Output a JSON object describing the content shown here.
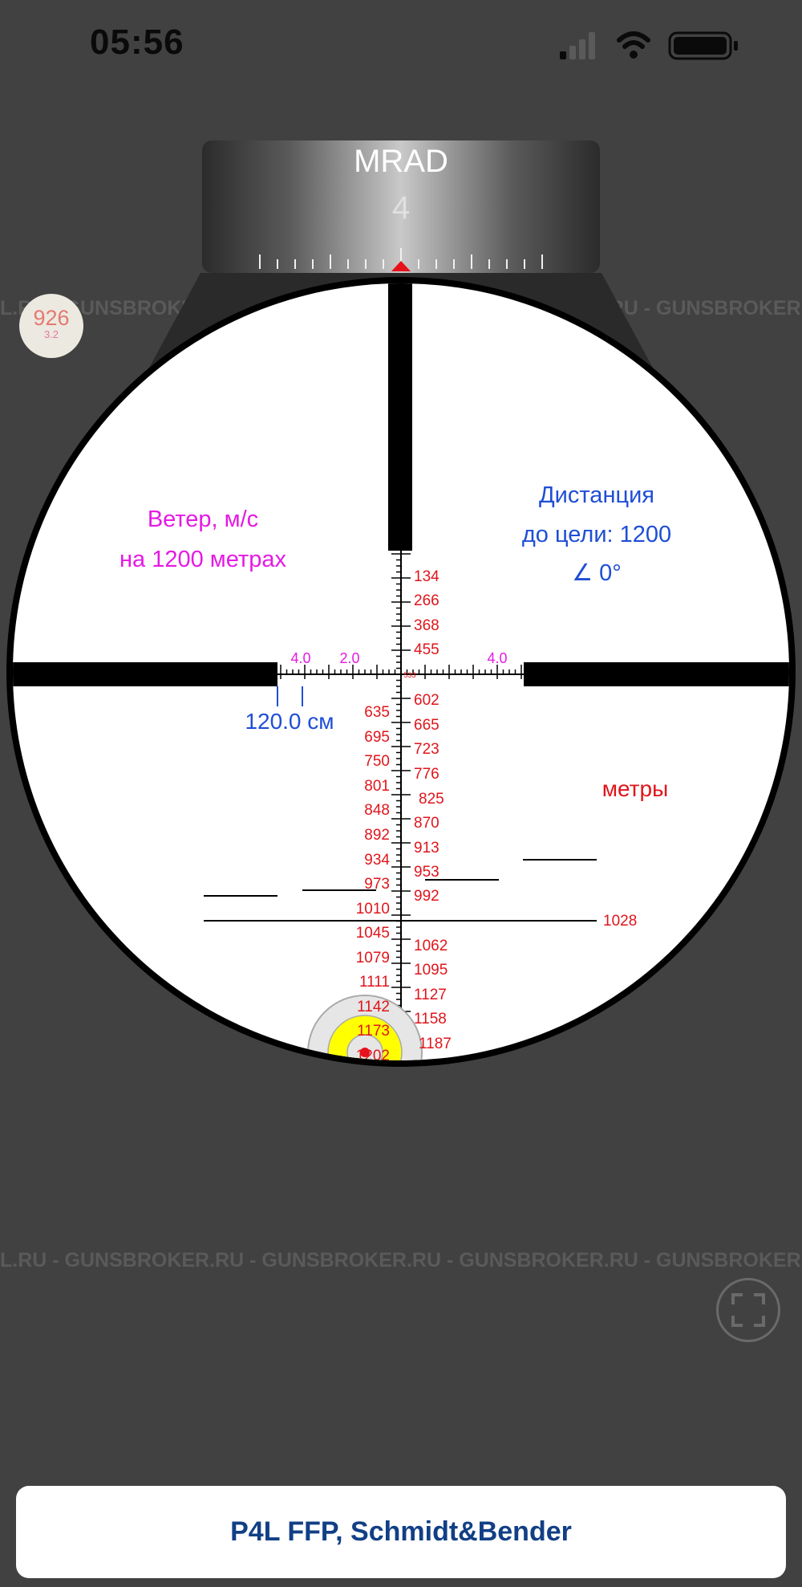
{
  "status_bar": {
    "time": "05:56"
  },
  "turret": {
    "unit": "MRAD",
    "value": "4"
  },
  "watermark": "L.RU - GUNSBROKER.RU - GUNSBROKER.RU - GUNSBROKER.RU - GUNSBROKER.RU - GUNSBROKER.RU - GUNSBROKER.RU",
  "badge": {
    "primary": "926",
    "secondary": "3.2"
  },
  "wind": {
    "line1": "Ветер, м/с",
    "line2": "на 1200 метрах"
  },
  "distance": {
    "line1": "Дистанция",
    "line2": "до цели: 1200",
    "angle": "∠ 0°"
  },
  "horizontal_marks": {
    "left_outer": "4.0",
    "left_inner": "2.0",
    "right": "4.0",
    "center": "533"
  },
  "width_label": "120.0 см",
  "units_label": "метры",
  "ranges_right": [
    "134",
    "266",
    "368",
    "455",
    "602",
    "665",
    "723",
    "776",
    "825",
    "870",
    "913",
    "953",
    "992",
    "1028",
    "1062",
    "1095",
    "1127",
    "1158",
    "1187"
  ],
  "ranges_left": [
    "635",
    "695",
    "750",
    "801",
    "848",
    "892",
    "934",
    "973",
    "1010",
    "1045",
    "1079",
    "1111",
    "1142",
    "1173",
    "1202"
  ],
  "bottom_card": {
    "title": "P4L FFP, Schmidt&Bender"
  },
  "colors": {
    "background": "#414141",
    "range_red": "#e0151b",
    "magenta": "#e51ae4",
    "blue": "#1f4ed6",
    "brand_navy": "#123f86"
  },
  "icons": [
    "signal-icon",
    "wifi-icon",
    "battery-icon",
    "fullscreen-icon",
    "target-icon"
  ]
}
